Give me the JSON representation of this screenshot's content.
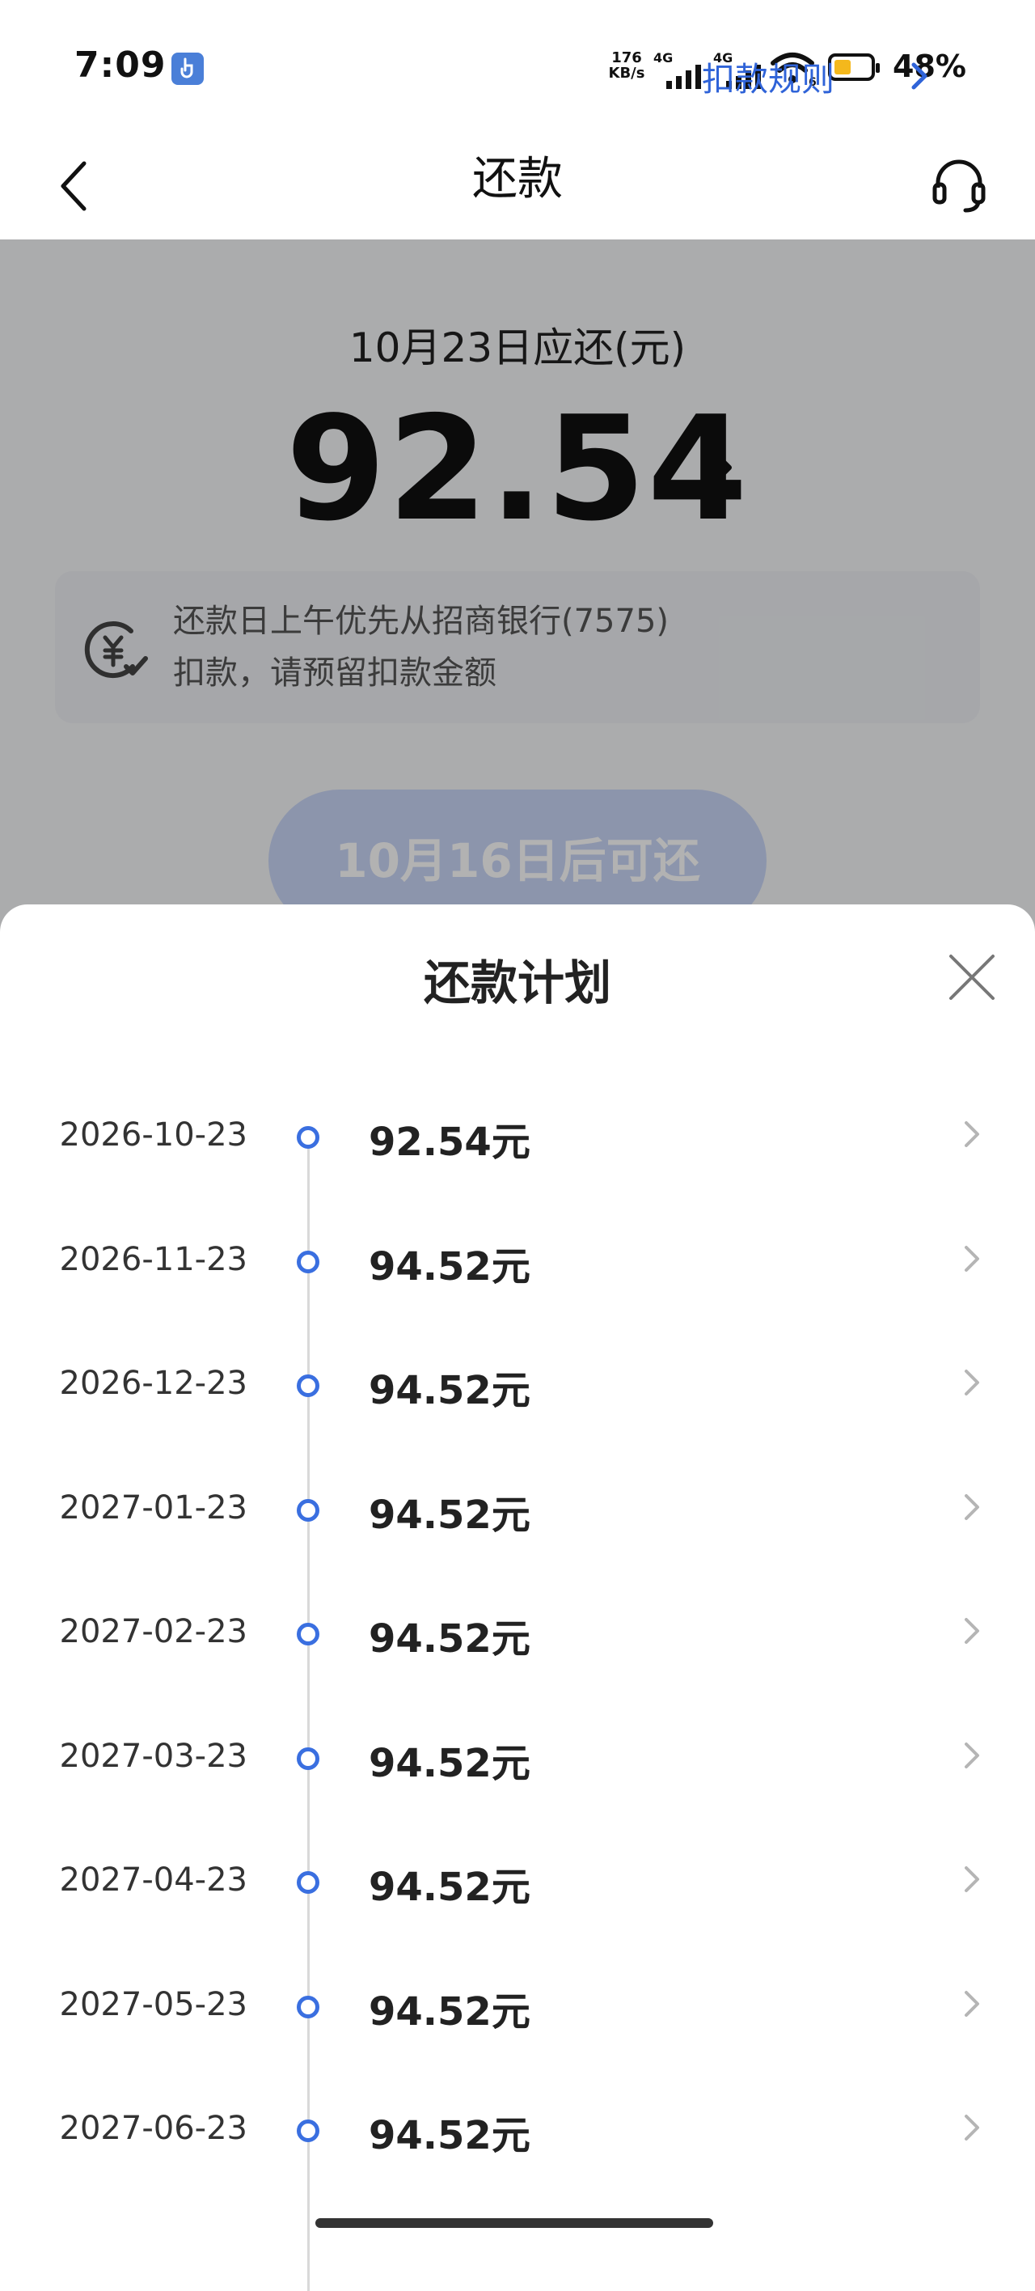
{
  "status_bar": {
    "time": "7:09",
    "net_speed_value": "176",
    "net_speed_unit": "KB/s",
    "network_1": "4G",
    "network_2": "4G",
    "wifi_badge": "6",
    "battery": "48%",
    "battery_level": 0.48
  },
  "header": {
    "title": "还款"
  },
  "repayment": {
    "due_label": "10月23日应还(元)",
    "due_amount": "92.54",
    "notice_line1": "还款日上午优先从招商银行(7575)",
    "notice_line2": "扣款，请预留扣款金额",
    "rule_link": "扣款规则",
    "repay_button": "10月16日后可还"
  },
  "plan_sheet": {
    "title": "还款计划",
    "unit": "元",
    "items": [
      {
        "date": "2026-10-23",
        "amount": "92.54"
      },
      {
        "date": "2026-11-23",
        "amount": "94.52"
      },
      {
        "date": "2026-12-23",
        "amount": "94.52"
      },
      {
        "date": "2027-01-23",
        "amount": "94.52"
      },
      {
        "date": "2027-02-23",
        "amount": "94.52"
      },
      {
        "date": "2027-03-23",
        "amount": "94.52"
      },
      {
        "date": "2027-04-23",
        "amount": "94.52"
      },
      {
        "date": "2027-05-23",
        "amount": "94.52"
      },
      {
        "date": "2027-06-23",
        "amount": "94.52"
      }
    ]
  },
  "colors": {
    "accent": "#3a6fe0",
    "link": "#2f63d8",
    "battery": "#f4b81c",
    "button_disabled": "#c9d6f7"
  },
  "icons": {
    "back": "chevron-left-icon",
    "service": "headset-icon",
    "amount_detail": "chevron-right-icon",
    "deduction": "yuan-check-icon",
    "close": "close-icon",
    "row": "chevron-right-icon"
  }
}
